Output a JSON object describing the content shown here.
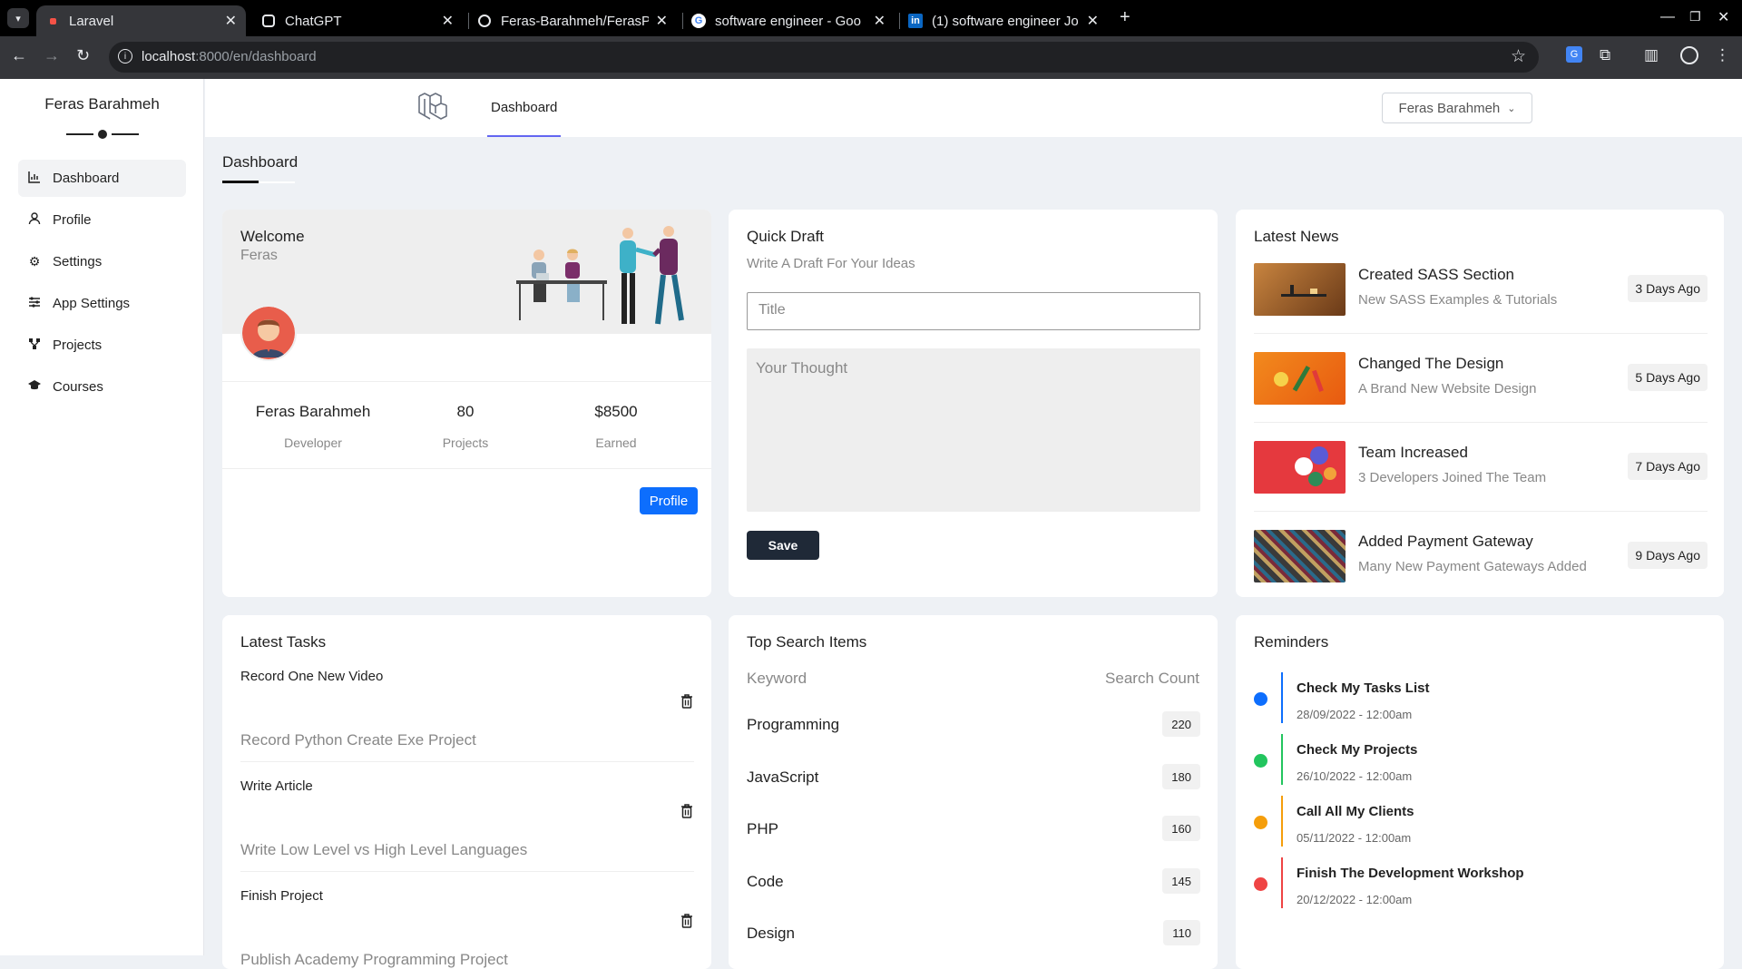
{
  "browser": {
    "tabs": [
      {
        "title": "Laravel",
        "icon": "laravel-favicon"
      },
      {
        "title": "ChatGPT",
        "icon": "chatgpt-favicon"
      },
      {
        "title": "Feras-Barahmeh/FerasP",
        "icon": "github-favicon"
      },
      {
        "title": "software engineer - Goo",
        "icon": "google-favicon"
      },
      {
        "title": "(1) software engineer Jo",
        "icon": "linkedin-favicon"
      }
    ],
    "new_tab": "+",
    "url_host": "localhost",
    "url_rest": ":8000/en/dashboard"
  },
  "sidebar": {
    "user_name": "Feras Barahmeh",
    "items": [
      {
        "label": "Dashboard",
        "icon": "chart-icon",
        "active": true
      },
      {
        "label": "Profile",
        "icon": "user-icon"
      },
      {
        "label": "Settings",
        "icon": "gear-icon"
      },
      {
        "label": "App Settings",
        "icon": "sliders-icon"
      },
      {
        "label": "Projects",
        "icon": "diagram-icon"
      },
      {
        "label": "Courses",
        "icon": "graduation-cap-icon"
      }
    ]
  },
  "topbar": {
    "nav_label": "Dashboard",
    "user_menu": "Feras Barahmeh"
  },
  "page_title": "Dashboard",
  "welcome": {
    "title": "Welcome",
    "name": "Feras",
    "stats": [
      {
        "value": "Feras Barahmeh",
        "label": "Developer"
      },
      {
        "value": "80",
        "label": "Projects"
      },
      {
        "value": "$8500",
        "label": "Earned"
      }
    ],
    "button": "Profile"
  },
  "draft": {
    "title": "Quick Draft",
    "subtitle": "Write A Draft For Your Ideas",
    "title_placeholder": "Title",
    "body_placeholder": "Your Thought",
    "save": "Save"
  },
  "news": {
    "title": "Latest News",
    "items": [
      {
        "title": "Created SASS Section",
        "desc": "New SASS Examples & Tutorials",
        "ago": "3 Days Ago"
      },
      {
        "title": "Changed The Design",
        "desc": "A Brand New Website Design",
        "ago": "5 Days Ago"
      },
      {
        "title": "Team Increased",
        "desc": "3 Developers Joined The Team",
        "ago": "7 Days Ago"
      },
      {
        "title": "Added Payment Gateway",
        "desc": "Many New Payment Gateways Added",
        "ago": "9 Days Ago"
      }
    ]
  },
  "tasks": {
    "title": "Latest Tasks",
    "items": [
      {
        "title": "Record One New Video",
        "desc": "Record Python Create Exe Project"
      },
      {
        "title": "Write Article",
        "desc": "Write Low Level vs High Level Languages"
      },
      {
        "title": "Finish Project",
        "desc": "Publish Academy Programming Project"
      }
    ]
  },
  "search": {
    "title": "Top Search Items",
    "col_keyword": "Keyword",
    "col_count": "Search Count",
    "rows": [
      {
        "keyword": "Programming",
        "count": "220"
      },
      {
        "keyword": "JavaScript",
        "count": "180"
      },
      {
        "keyword": "PHP",
        "count": "160"
      },
      {
        "keyword": "Code",
        "count": "145"
      },
      {
        "keyword": "Design",
        "count": "110"
      }
    ]
  },
  "reminders": {
    "title": "Reminders",
    "items": [
      {
        "title": "Check My Tasks List",
        "date": "28/09/2022 - 12:00am",
        "color": "#0d6efd"
      },
      {
        "title": "Check My Projects",
        "date": "26/10/2022 - 12:00am",
        "color": "#22c55e"
      },
      {
        "title": "Call All My Clients",
        "date": "05/11/2022 - 12:00am",
        "color": "#f59e0b"
      },
      {
        "title": "Finish The Development Workshop",
        "date": "20/12/2022 - 12:00am",
        "color": "#ef4444"
      }
    ]
  }
}
